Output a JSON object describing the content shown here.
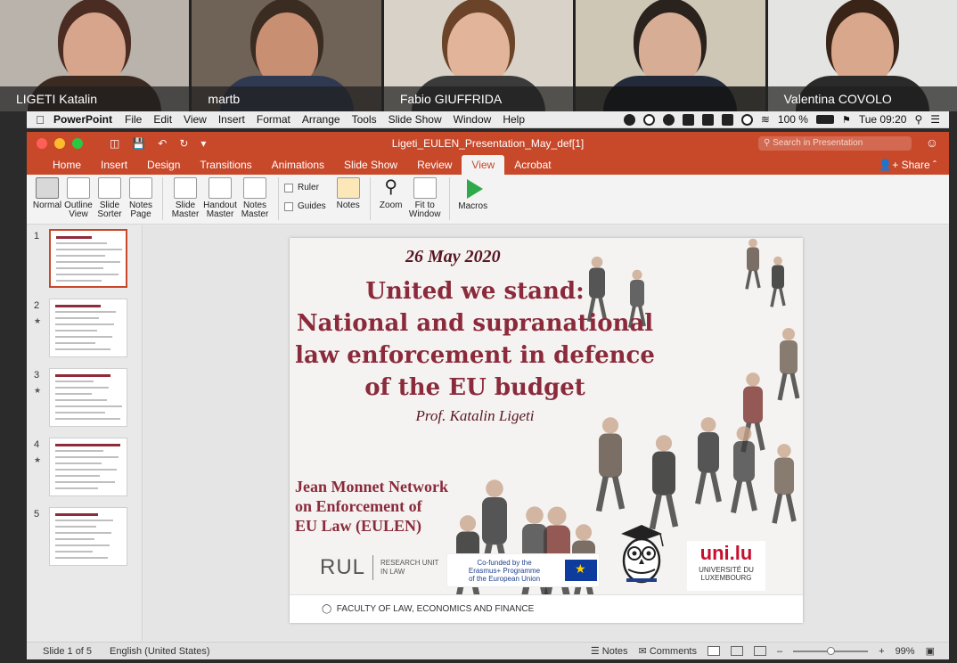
{
  "participants": [
    {
      "name": "LIGETI Katalin",
      "bg": "#b9b3ab",
      "skin": "#d7a58b",
      "hair": "#4a2c22",
      "shirt": "#3a2a22"
    },
    {
      "name": "martb",
      "bg": "#6f6358",
      "skin": "#c98f72",
      "hair": "#3b2c22",
      "shirt": "#2f3a52"
    },
    {
      "name": "Fabio GIUFFRIDA",
      "bg": "#d8d2c9",
      "skin": "#e2b49a",
      "hair": "#6b4328",
      "shirt": "#3b3b3b"
    },
    {
      "name": "",
      "bg": "#cfc7b6",
      "skin": "#d8ad95",
      "hair": "#2a221c",
      "shirt": "#232a3a"
    },
    {
      "name": "Valentina COVOLO",
      "bg": "#e4e4e2",
      "skin": "#d9a78c",
      "hair": "#3a2418",
      "shirt": "#2a2a2a"
    }
  ],
  "menubar": {
    "app": "PowerPoint",
    "items": [
      "File",
      "Edit",
      "View",
      "Insert",
      "Format",
      "Arrange",
      "Tools",
      "Slide Show",
      "Window",
      "Help"
    ],
    "battery": "100 %",
    "clock": "Tue 09:20"
  },
  "window": {
    "title": "Ligeti_EULEN_Presentation_May_def[1]",
    "search_placeholder": "Search in Presentation",
    "share": "Share"
  },
  "ribbon_tabs": [
    {
      "label": "Home"
    },
    {
      "label": "Insert"
    },
    {
      "label": "Design"
    },
    {
      "label": "Transitions"
    },
    {
      "label": "Animations"
    },
    {
      "label": "Slide Show"
    },
    {
      "label": "Review"
    },
    {
      "label": "View",
      "active": true
    },
    {
      "label": "Acrobat"
    }
  ],
  "ribbon": {
    "views": [
      "Normal",
      "Outline View",
      "Slide Sorter",
      "Notes Page"
    ],
    "masters": [
      "Slide Master",
      "Handout Master",
      "Notes Master"
    ],
    "ruler": "Ruler",
    "guides": "Guides",
    "notes": "Notes",
    "zoom": "Zoom",
    "fit": "Fit to Window",
    "macros": "Macros"
  },
  "thumbnails": [
    {
      "num": "1",
      "star": false,
      "selected": true
    },
    {
      "num": "2",
      "star": true,
      "selected": false
    },
    {
      "num": "3",
      "star": true,
      "selected": false
    },
    {
      "num": "4",
      "star": true,
      "selected": false
    },
    {
      "num": "5",
      "star": false,
      "selected": false
    }
  ],
  "slide": {
    "date": "26 May 2020",
    "title_lines": [
      "United we stand:",
      "National and supranational",
      "law enforcement in defence",
      "of the EU budget"
    ],
    "author": "Prof. Katalin Ligeti",
    "network_lines": [
      "Jean Monnet Network",
      "on Enforcement of",
      "EU Law (EULEN)"
    ],
    "rul": "RUL",
    "rul_sub_1": "RESEARCH UNIT",
    "rul_sub_2": "IN LAW",
    "erasmus_1": "Co-funded by the",
    "erasmus_2": "Erasmus+ Programme",
    "erasmus_3": "of the European Union",
    "unilu_logo": "uni.lu",
    "unilu_sub_1": "UNIVERSITÉ DU",
    "unilu_sub_2": "LUXEMBOURG",
    "footer": "FACULTY OF LAW, ECONOMICS AND FINANCE"
  },
  "status": {
    "slide_of": "Slide 1 of 5",
    "language": "English (United States)",
    "notes": "Notes",
    "comments": "Comments",
    "zoom": "99%"
  },
  "colors": {
    "accent": "#c8482a",
    "title_maroon": "#8b2a3b"
  }
}
